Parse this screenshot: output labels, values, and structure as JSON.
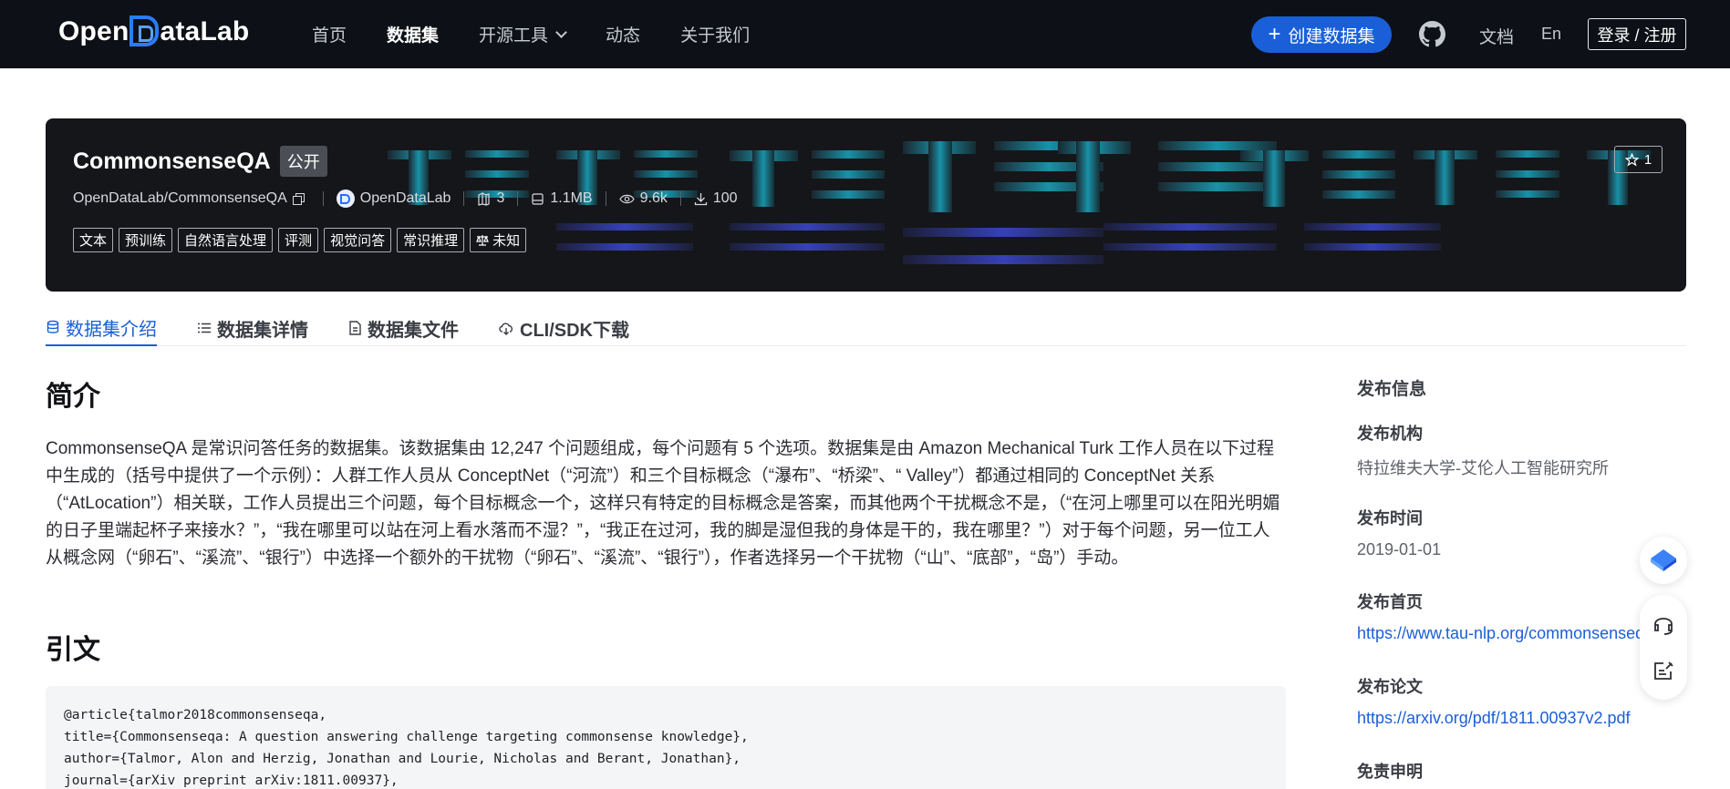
{
  "nav": {
    "logo_pre": "Open",
    "logo_post": "ataLab",
    "links": [
      "首页",
      "数据集",
      "开源工具",
      "动态",
      "关于我们"
    ],
    "create_label": "创建数据集",
    "docs_label": "文档",
    "lang_label": "En",
    "login_label": "登录 / 注册"
  },
  "dataset": {
    "title": "CommonsenseQA",
    "visibility": "公开",
    "repo": "OpenDataLab/CommonsenseQA",
    "org": "OpenDataLab",
    "files": "3",
    "size": "1.1MB",
    "views": "9.6k",
    "downloads": "100",
    "tags": [
      "文本",
      "预训练",
      "自然语言处理",
      "评测",
      "视觉问答",
      "常识推理"
    ],
    "license": "未知",
    "stars": "1"
  },
  "tabs": [
    "数据集介绍",
    "数据集详情",
    "数据集文件",
    "CLI/SDK下载"
  ],
  "intro": {
    "heading": "简介",
    "text": "CommonsenseQA 是常识问答任务的数据集。该数据集由 12,247 个问题组成，每个问题有 5 个选项。数据集是由 Amazon Mechanical Turk 工作人员在以下过程中生成的（括号中提供了一个示例）：人群工作人员从 ConceptNet（“河流”）和三个目标概念（“瀑布”、“桥梁”、“ Valley”）都通过相同的 ConceptNet 关系（“AtLocation”）相关联，工作人员提出三个问题，每个目标概念一个，这样只有特定的目标概念是答案，而其他两个干扰概念不是，（“在河上哪里可以在阳光明媚的日子里端起杯子来接水？”，“我在哪里可以站在河上看水落而不湿？”，“我正在过河，我的脚是湿但我的身体是干的，我在哪里？”）对于每个问题，另一位工人从概念网（“卵石”、“溪流”、“银行”）中选择一个额外的干扰物（“卵石”、“溪流”、“银行”），作者选择另一个干扰物（“山”、“底部”，“岛”）手动。"
  },
  "citation": {
    "heading": "引文",
    "code": "@article{talmor2018commonsenseqa,\ntitle={Commonsenseqa: A question answering challenge targeting commonsense knowledge},\nauthor={Talmor, Alon and Herzig, Jonathan and Lourie, Nicholas and Berant, Jonathan},\njournal={arXiv preprint arXiv:1811.00937},"
  },
  "side": {
    "title": "发布信息",
    "org_label": "发布机构",
    "org_value": "特拉维夫大学-艾伦人工智能研究所",
    "date_label": "发布时间",
    "date_value": "2019-01-01",
    "home_label": "发布首页",
    "home_value": "https://www.tau-nlp.org/commonsenseqa",
    "paper_label": "发布论文",
    "paper_value": "https://arxiv.org/pdf/1811.00937v2.pdf",
    "disclaimer_label": "免责申明"
  },
  "colors": {
    "accent": "#1a5fd8",
    "nav_bg": "#0d1117",
    "banner_bg": "#151619"
  }
}
